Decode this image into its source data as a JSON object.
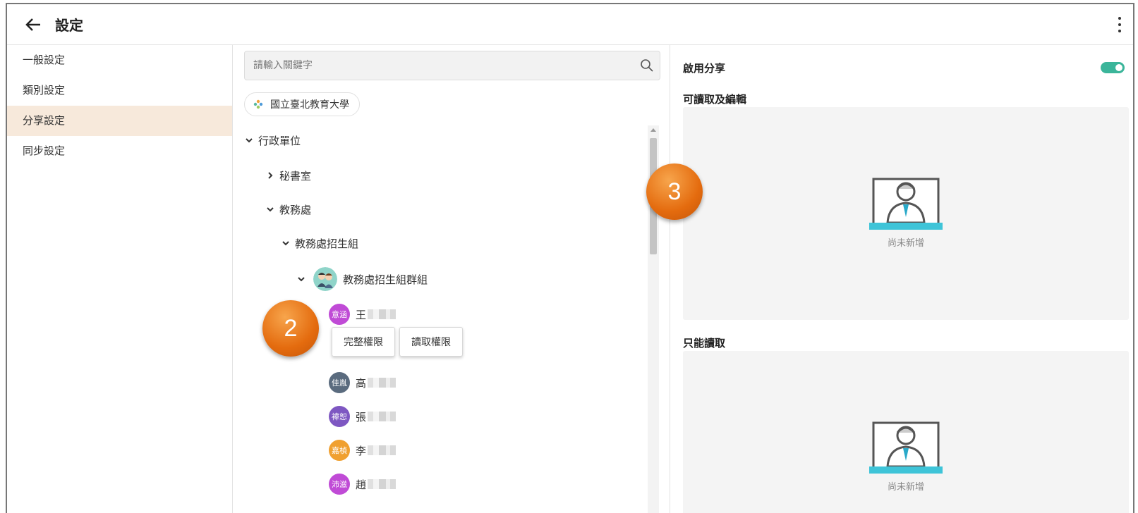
{
  "header": {
    "title": "設定"
  },
  "sidebar": {
    "items": [
      {
        "label": "一般設定"
      },
      {
        "label": "類別設定"
      },
      {
        "label": "分享設定"
      },
      {
        "label": "同步設定"
      }
    ],
    "active_color": "#f7e9db"
  },
  "search": {
    "placeholder": "請輸入關鍵字"
  },
  "org": {
    "name": "國立臺北教育大學"
  },
  "tree": {
    "root": "行政單位",
    "secretary": "秘書室",
    "academic": "教務處",
    "admissions": "教務處招生組",
    "group": "教務處招生組群組",
    "members": [
      {
        "avatar": "意涵",
        "name": "王",
        "color": "#c04bd6"
      },
      {
        "avatar": "佳胤",
        "name": "高",
        "color": "#5a6b7e"
      },
      {
        "avatar": "褘恕",
        "name": "張",
        "color": "#7e57c2"
      },
      {
        "avatar": "嘉楨",
        "name": "李",
        "color": "#f0a030"
      },
      {
        "avatar": "沛滋",
        "name": "趙",
        "color": "#c04bd6"
      }
    ]
  },
  "permissions": {
    "full": "完整權限",
    "read": "讀取權限"
  },
  "sharing": {
    "enable_label": "啟用分享",
    "enabled": true,
    "toggle_color": "#3bb59a",
    "edit_label": "可讀取及編輯",
    "readonly_label": "只能讀取",
    "empty_text": "尚未新增"
  },
  "callouts": {
    "two": "2",
    "three": "3"
  }
}
